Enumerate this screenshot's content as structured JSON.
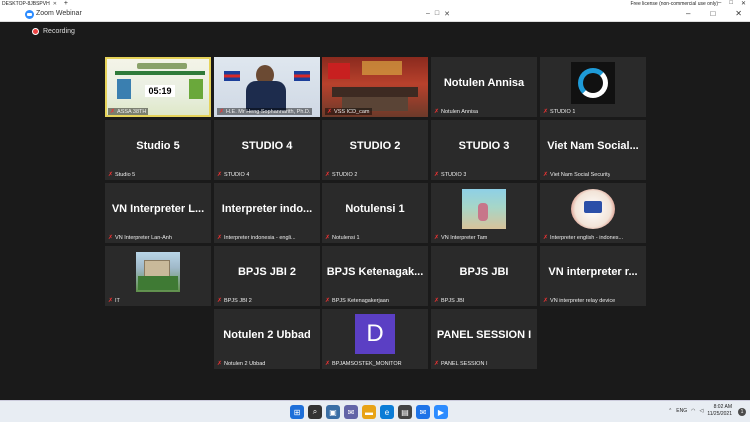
{
  "rdp": {
    "tab_title": "DESKTOP-8JBSPVH",
    "license": "Free license (non-commercial use only)"
  },
  "window": {
    "title": "Zoom Webinar"
  },
  "recording": {
    "label": "Recording"
  },
  "tiles": [
    {
      "name": "",
      "label": "ASSA 38TH",
      "type": "video-assa",
      "overlay": "05:19"
    },
    {
      "name": "",
      "label": "H.E. Mr Heng Sophannarith, Ph.D.",
      "type": "video-speaker"
    },
    {
      "name": "",
      "label": "VSS ICD_cam",
      "type": "video-room"
    },
    {
      "name": "Notulen Annisa",
      "label": "Notulen Annisa",
      "type": "text"
    },
    {
      "name": "",
      "label": "STUDIO 1",
      "type": "logo-studio1"
    },
    {
      "name": "Studio 5",
      "label": "Studio 5",
      "type": "text"
    },
    {
      "name": "STUDIO 4",
      "label": "STUDIO 4",
      "type": "text"
    },
    {
      "name": "STUDIO 2",
      "label": "STUDIO 2",
      "type": "text"
    },
    {
      "name": "STUDIO 3",
      "label": "STUDIO 3",
      "type": "text"
    },
    {
      "name": "Viet Nam Social...",
      "label": "Viet Nam Social Security",
      "type": "text"
    },
    {
      "name": "VN Interpreter L...",
      "label": "VN Interpreter Lan-Anh",
      "type": "text"
    },
    {
      "name": "Interpreter indo...",
      "label": "Interpreter indonesia - engli...",
      "type": "text"
    },
    {
      "name": "Notulensi 1",
      "label": "Notulensi 1",
      "type": "text"
    },
    {
      "name": "",
      "label": "VN Interpreter Tam",
      "type": "photo-tam"
    },
    {
      "name": "",
      "label": "Interpreter english - indones...",
      "type": "logo-interp"
    },
    {
      "name": "",
      "label": "IT",
      "type": "photo-building"
    },
    {
      "name": "BPJS JBI 2",
      "label": "BPJS JBI 2",
      "type": "text"
    },
    {
      "name": "BPJS Ketenagak...",
      "label": "BPJS Ketenagakerjaan",
      "type": "text"
    },
    {
      "name": "BPJS JBI",
      "label": "BPJS JBI",
      "type": "text"
    },
    {
      "name": "VN interpreter r...",
      "label": "VN interpreter relay device",
      "type": "text"
    },
    {
      "name": "Notulen 2 Ubbad",
      "label": "Notulen 2 Ubbad",
      "type": "text"
    },
    {
      "name": "",
      "label": "BPJAMSOSTEK_MONITOR",
      "type": "avatar-d",
      "initial": "D"
    },
    {
      "name": "PANEL SESSION I",
      "label": "PANEL SESSION I",
      "type": "text"
    }
  ],
  "taskbar": {
    "lang": "ENG",
    "time": "8:02 AM",
    "date": "11/25/2021",
    "notifications": "1"
  },
  "colors": {
    "background": "#1a1a1a",
    "tile": "#2a2a2a",
    "muted_mic": "#e33333",
    "zoom_blue": "#2d8cff",
    "avatar_purple": "#5b3fc4"
  }
}
